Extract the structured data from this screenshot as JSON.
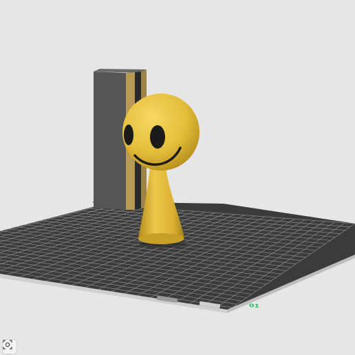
{
  "viewport": {
    "background": "#e6e6e6",
    "bed_label": "01",
    "bed_label_color": "#1fc05a",
    "bed_color": "#3b3b3b",
    "grid_color": "#8a8a8a"
  },
  "objects": {
    "block_color": "#555555",
    "block_stripe_color": "#b89a54",
    "figure_color": "#e4bd3a",
    "figure_eye_color": "#1b1b1b"
  },
  "toolbar": {
    "view_button_icon": "camera-view-icon"
  }
}
